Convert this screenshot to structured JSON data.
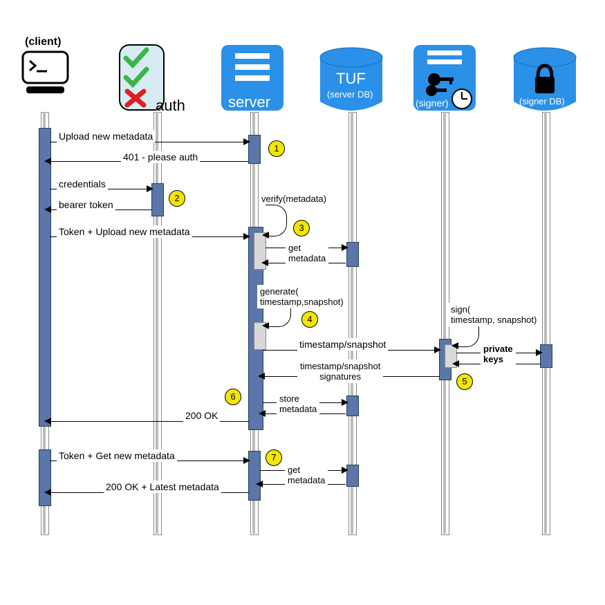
{
  "participants": {
    "client": {
      "label": "(client)"
    },
    "auth": {
      "label": "auth"
    },
    "server": {
      "label": "server"
    },
    "tuf": {
      "label": "TUF",
      "sub": "(server DB)"
    },
    "signer": {
      "label": "(signer)"
    },
    "signerdb": {
      "label": "(signer DB)"
    }
  },
  "messages": {
    "m1": "Upload new metadata",
    "m2": "401 - please auth",
    "m3": "credentials",
    "m4": "bearer token",
    "m5": "Token + Upload new metadata",
    "m6": "verify(metadata)",
    "m7a": "get",
    "m7b": "metadata",
    "m8a": "generate(",
    "m8b": "timestamp,snapshot)",
    "m9a": "sign(",
    "m9b": "timestamp, snapshot)",
    "m10": "timestamp/snapshot",
    "m11a": "timestamp/snapshot",
    "m11b": "signatures",
    "m12": "private",
    "m12b": "keys",
    "m13a": "store",
    "m13b": "metadata",
    "m14": "200 OK",
    "m15": "Token + Get new metadata",
    "m16": "200 OK + Latest metadata",
    "m17a": "get",
    "m17b": "metadata"
  },
  "steps": {
    "s1": "1",
    "s2": "2",
    "s3": "3",
    "s4": "4",
    "s5": "5",
    "s6": "6",
    "s7": "7"
  }
}
